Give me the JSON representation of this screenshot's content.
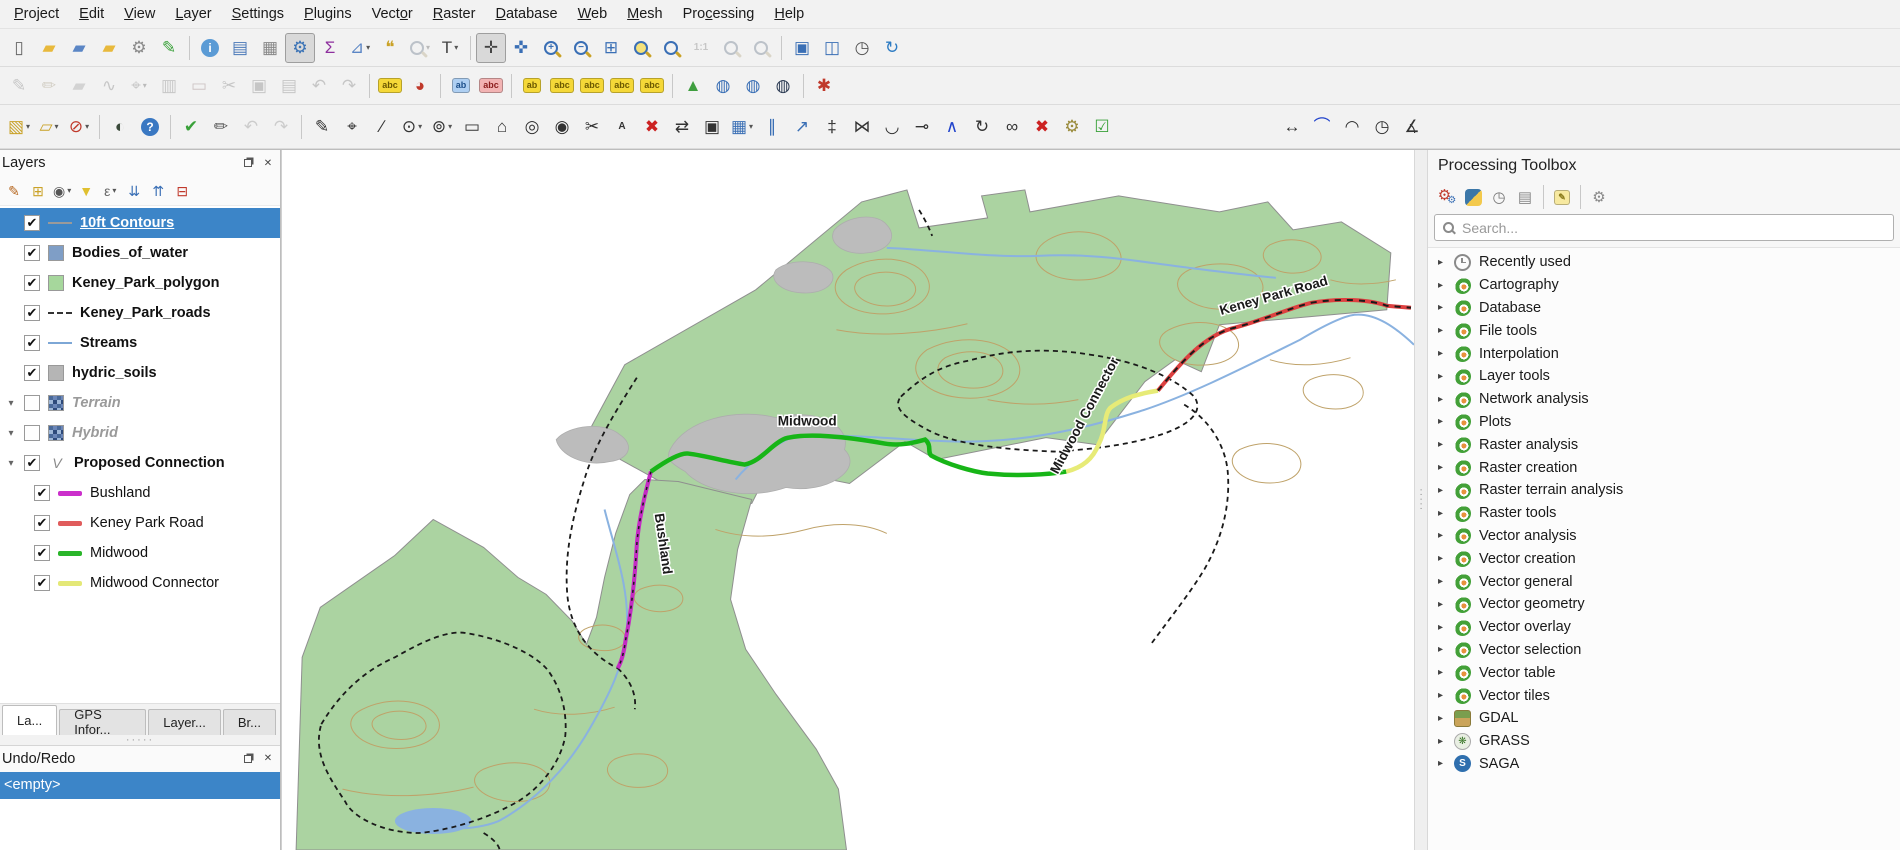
{
  "icons": {
    "close": "✕",
    "dropdown": "▾",
    "expander": "▾",
    "check": "✔",
    "tree_arrow": "▸",
    "grass_glyph": "❋",
    "saga_glyph": "S",
    "splitter_dots": "·····"
  },
  "menu": {
    "items": [
      {
        "label": "Project",
        "u": 0
      },
      {
        "label": "Edit",
        "u": 0
      },
      {
        "label": "View",
        "u": 0
      },
      {
        "label": "Layer",
        "u": 0
      },
      {
        "label": "Settings",
        "u": 0
      },
      {
        "label": "Plugins",
        "u": 0
      },
      {
        "label": "Vector",
        "u": 4
      },
      {
        "label": "Raster",
        "u": 0
      },
      {
        "label": "Database",
        "u": 0
      },
      {
        "label": "Web",
        "u": 0
      },
      {
        "label": "Mesh",
        "u": 0
      },
      {
        "label": "Processing",
        "u": 3
      },
      {
        "label": "Help",
        "u": 0
      }
    ]
  },
  "toolbars": {
    "row1": [
      {
        "n": "new-project",
        "g": "▯",
        "c": "#666"
      },
      {
        "n": "open-project",
        "g": "▰",
        "c": "#e8b93c"
      },
      {
        "n": "save-project",
        "g": "▰",
        "c": "#5b86c5"
      },
      {
        "n": "save-project-as",
        "g": "▰",
        "c": "#e8b93c"
      },
      {
        "n": "project-properties",
        "g": "⚙",
        "c": "#8a8a8a"
      },
      {
        "n": "style-manager",
        "g": "✎",
        "c": "#3aa13a"
      },
      {
        "sep": true
      },
      {
        "n": "identify-features",
        "g": "i",
        "c": "#fff",
        "round": true,
        "chipbg": "#5b9bd5"
      },
      {
        "n": "open-attribute-table",
        "g": "▤",
        "c": "#4a78b8"
      },
      {
        "n": "statistical-summary",
        "g": "▦",
        "c": "#888"
      },
      {
        "n": "processing-toolbox-toggle",
        "g": "⚙",
        "c": "#3871b5",
        "st": "checked"
      },
      {
        "n": "show-statistics",
        "g": "Σ",
        "c": "#8e2f9e"
      },
      {
        "n": "measure",
        "g": "⊿",
        "c": "#5b86c5",
        "dd": true
      },
      {
        "n": "map-tips",
        "g": "❝",
        "c": "#caa227"
      },
      {
        "n": "zoom-tool",
        "lens": true,
        "st": "disabled",
        "dd": true
      },
      {
        "n": "text-annotation",
        "g": "T",
        "c": "#444",
        "dd": true
      },
      {
        "sep": true
      },
      {
        "n": "pan-map",
        "g": "✛",
        "c": "#444",
        "st": "checked"
      },
      {
        "n": "pan-to-selection",
        "g": "✜",
        "c": "#3a6fb5"
      },
      {
        "n": "zoom-in",
        "lens": true,
        "g": "+"
      },
      {
        "n": "zoom-out",
        "lens": true,
        "g": "−"
      },
      {
        "n": "zoom-full",
        "g": "⊞",
        "c": "#3a6fb5"
      },
      {
        "n": "zoom-to-selection",
        "lens": true,
        "lensbg": "#f5e27a"
      },
      {
        "n": "zoom-to-layer",
        "lens": true
      },
      {
        "n": "zoom-native",
        "g": "1:1",
        "c": "#777",
        "small": true,
        "st": "disabled"
      },
      {
        "n": "zoom-last",
        "lens": true,
        "st": "disabled"
      },
      {
        "n": "zoom-next",
        "lens": true,
        "st": "disabled"
      },
      {
        "sep": true
      },
      {
        "n": "new-map-view",
        "g": "▣",
        "c": "#3a6fb5"
      },
      {
        "n": "new-3d-map-view",
        "g": "◫",
        "c": "#3a6fb5"
      },
      {
        "n": "temporal-controller",
        "g": "◷",
        "c": "#555"
      },
      {
        "n": "refresh-map",
        "g": "↻",
        "c": "#2e7cc3"
      }
    ],
    "row2": [
      {
        "n": "current-edits",
        "g": "✎",
        "c": "#777",
        "st": "disabled"
      },
      {
        "n": "toggle-editing",
        "g": "✏",
        "c": "#b08d2a",
        "st": "disabled"
      },
      {
        "n": "save-layer-edits",
        "g": "▰",
        "c": "#9a9a9a",
        "st": "disabled"
      },
      {
        "n": "add-line-feature",
        "g": "∿",
        "c": "#777",
        "st": "disabled"
      },
      {
        "n": "vertex-tool",
        "g": "⌖",
        "c": "#777",
        "st": "disabled",
        "dd": true
      },
      {
        "n": "multiedit-attributes",
        "g": "▥",
        "c": "#777",
        "st": "disabled"
      },
      {
        "n": "delete-selected",
        "g": "▭",
        "c": "#b66",
        "st": "disabled"
      },
      {
        "n": "cut-features",
        "g": "✂",
        "c": "#777",
        "st": "disabled"
      },
      {
        "n": "copy-features",
        "g": "▣",
        "c": "#777",
        "st": "disabled"
      },
      {
        "n": "paste-features",
        "g": "▤",
        "c": "#777",
        "st": "disabled"
      },
      {
        "n": "undo",
        "g": "↶",
        "c": "#777",
        "st": "disabled"
      },
      {
        "n": "redo",
        "g": "↷",
        "c": "#777",
        "st": "disabled"
      },
      {
        "sep": true
      },
      {
        "n": "layer-labeling",
        "chip": "abc",
        "chipbg": "#f5d838",
        "c": "#6b5800"
      },
      {
        "n": "layer-diagram",
        "g": "◕",
        "c": "#c0392b"
      },
      {
        "sep": true
      },
      {
        "n": "highlight-pinned-labels",
        "chip": "ab",
        "chipbg": "#aecff2",
        "c": "#1c4f8a"
      },
      {
        "n": "toggle-label-display",
        "chip": "abc",
        "chipbg": "#f2b3b3",
        "c": "#8a1c1c"
      },
      {
        "sep": true
      },
      {
        "n": "pin-unpin-labels",
        "chip": "ab",
        "chipbg": "#f5d838",
        "c": "#6b5800"
      },
      {
        "n": "show-hide-labels",
        "chip": "abc",
        "chipbg": "#f5d838",
        "c": "#6b5800"
      },
      {
        "n": "move-label",
        "chip": "abc",
        "chipbg": "#f5d838",
        "c": "#6b5800"
      },
      {
        "n": "rotate-label",
        "chip": "abc",
        "chipbg": "#f5d838",
        "c": "#6b5800"
      },
      {
        "n": "change-label",
        "chip": "abc",
        "chipbg": "#f5d838",
        "c": "#6b5800"
      },
      {
        "sep": true
      },
      {
        "n": "decorations",
        "g": "▲",
        "c": "#3f9e3f"
      },
      {
        "n": "metasearch",
        "g": "◍",
        "c": "#3a6fb5"
      },
      {
        "n": "web-globe",
        "g": "◍",
        "c": "#3a6fb5"
      },
      {
        "n": "metasearch-dark",
        "g": "◍",
        "c": "#2b3a52"
      },
      {
        "sep": true
      },
      {
        "n": "plugin-tool",
        "g": "✱",
        "c": "#c0392b"
      }
    ],
    "row3": [
      {
        "n": "select-features",
        "g": "▧",
        "c": "#c9a227",
        "dd": true
      },
      {
        "n": "select-by-form",
        "g": "▱",
        "c": "#c9a227",
        "dd": true
      },
      {
        "n": "deselect-features",
        "g": "⊘",
        "c": "#c0392b",
        "dd": true
      },
      {
        "sep": true
      },
      {
        "n": "night-sphere",
        "g": "◐",
        "c": "#3a4a3a"
      },
      {
        "n": "help-contents",
        "g": "?",
        "c": "#fff",
        "round": true,
        "chipbg": "#3a78c2"
      },
      {
        "sep": true
      },
      {
        "n": "snapping-toggle",
        "g": "✔",
        "c": "#3aa13a"
      },
      {
        "n": "edit-pencil",
        "g": "✏",
        "c": "#555"
      },
      {
        "n": "undo-edit",
        "g": "↶",
        "c": "#888",
        "st": "disabled"
      },
      {
        "n": "redo-edit",
        "g": "↷",
        "c": "#888",
        "st": "disabled"
      },
      {
        "sep": true
      },
      {
        "n": "digitize-curve",
        "g": "✎",
        "c": "#333"
      },
      {
        "n": "digitize-point",
        "g": "⌖",
        "c": "#333"
      },
      {
        "n": "digitize-line",
        "g": "∕",
        "c": "#333"
      },
      {
        "n": "digitize-circle",
        "g": "⊙",
        "c": "#333",
        "dd": true
      },
      {
        "n": "digitize-ellipse",
        "g": "⊚",
        "c": "#333",
        "dd": true
      },
      {
        "n": "digitize-rect",
        "g": "▭",
        "c": "#333"
      },
      {
        "n": "digitize-polygon",
        "g": "⌂",
        "c": "#333"
      },
      {
        "n": "digitize-annulus",
        "g": "◎",
        "c": "#333"
      },
      {
        "n": "stamp-tool",
        "g": "◉",
        "c": "#333"
      },
      {
        "n": "split-features",
        "g": "✂",
        "c": "#333"
      },
      {
        "n": "marker-a",
        "g": "A",
        "c": "#333",
        "small": true
      },
      {
        "n": "delete-part",
        "g": "✖",
        "c": "#cc2222"
      },
      {
        "n": "move-feature",
        "g": "⇄",
        "c": "#333"
      },
      {
        "n": "copy-move-feature",
        "g": "▣",
        "c": "#333"
      },
      {
        "n": "grid-tool",
        "g": "▦",
        "c": "#3a6fb5",
        "dd": true
      },
      {
        "n": "parallel-lines",
        "g": "∥",
        "c": "#3a6fb5"
      },
      {
        "n": "arrow-tool",
        "g": "↗",
        "c": "#3a6fb5"
      },
      {
        "n": "offset-tool",
        "g": "‡",
        "c": "#333"
      },
      {
        "n": "mirror-tool",
        "g": "⋈",
        "c": "#333"
      },
      {
        "n": "fillet-tool",
        "g": "◡",
        "c": "#333"
      },
      {
        "n": "extend-tool",
        "g": "⊸",
        "c": "#333"
      },
      {
        "n": "vertex-plus",
        "g": "∧",
        "c": "#2244cc"
      },
      {
        "n": "rotate-point",
        "g": "↻",
        "c": "#333"
      },
      {
        "n": "merge-lines",
        "g": "∞",
        "c": "#333"
      },
      {
        "n": "delete-red",
        "g": "✖",
        "c": "#cc2222"
      },
      {
        "n": "spanner",
        "g": "⚙",
        "c": "#998a3a"
      },
      {
        "n": "validate",
        "g": "☑",
        "c": "#3aa13a"
      },
      {
        "gap": true
      },
      {
        "n": "measure-length",
        "g": "↔",
        "c": "#333"
      },
      {
        "n": "measure-curve",
        "g": "⌒",
        "c": "#2244cc"
      },
      {
        "n": "measure-arc",
        "g": "◠",
        "c": "#333"
      },
      {
        "n": "measure-angle-clock",
        "g": "◷",
        "c": "#333"
      },
      {
        "n": "measure-azimuth",
        "g": "∡",
        "c": "#333"
      }
    ]
  },
  "layers_panel": {
    "title": "Layers",
    "toolbar": [
      {
        "n": "open-layer-styling",
        "g": "✎",
        "c": "#b5651d"
      },
      {
        "n": "add-group",
        "g": "⊞",
        "c": "#caa227"
      },
      {
        "n": "manage-map-themes",
        "g": "◉",
        "c": "#555",
        "dd": true
      },
      {
        "n": "filter-legend",
        "g": "▼",
        "c": "#e0c030"
      },
      {
        "n": "filter-by-expression",
        "g": "ε",
        "c": "#666",
        "dd": true
      },
      {
        "n": "expand-all",
        "g": "⇊",
        "c": "#3a6fb5"
      },
      {
        "n": "collapse-all",
        "g": "⇈",
        "c": "#3a6fb5"
      },
      {
        "n": "remove-layer",
        "g": "⊟",
        "c": "#c0392b"
      }
    ],
    "items": [
      {
        "label": "10ft Contours",
        "checked": true,
        "selected": true,
        "swatch": "line",
        "color": "#9a9a9a"
      },
      {
        "label": "Bodies_of_water",
        "checked": true,
        "swatch": "fill",
        "color": "#7f9ec6"
      },
      {
        "label": "Keney_Park_polygon",
        "checked": true,
        "swatch": "fill",
        "color": "#a6d79c"
      },
      {
        "label": "Keney_Park_roads",
        "checked": true,
        "swatch": "dash",
        "color": "#333333"
      },
      {
        "label": "Streams",
        "checked": true,
        "swatch": "line",
        "color": "#7da7d6"
      },
      {
        "label": "hydric_soils",
        "checked": true,
        "swatch": "fill",
        "color": "#b5b5b5"
      },
      {
        "label": "Terrain",
        "checked": false,
        "italic": true,
        "expander": true,
        "swatch": "tiles"
      },
      {
        "label": "Hybrid",
        "checked": false,
        "italic": true,
        "expander": true,
        "swatch": "tiles"
      },
      {
        "label": "Proposed Connection",
        "checked": true,
        "expander": true,
        "swatch": "vector",
        "glyph": "V"
      },
      {
        "label": "Bushland",
        "checked": true,
        "child": true,
        "swatch": "thickline",
        "color": "#cb2fcb"
      },
      {
        "label": "Keney Park Road",
        "checked": true,
        "child": true,
        "swatch": "thickline",
        "color": "#e05c5c"
      },
      {
        "label": "Midwood",
        "checked": true,
        "child": true,
        "swatch": "thickline",
        "color": "#2ab52a"
      },
      {
        "label": "Midwood Connector",
        "checked": true,
        "child": true,
        "swatch": "thickline",
        "color": "#e4e877"
      }
    ],
    "tabs": {
      "active": 0,
      "items": [
        "La...",
        "GPS Infor...",
        "Layer...",
        "Br..."
      ]
    }
  },
  "undo_panel": {
    "title": "Undo/Redo",
    "rows": [
      "<empty>"
    ]
  },
  "map": {
    "labels": {
      "midwood": "Midwood",
      "midwood_connector": "Midwood Connector",
      "bushland": "Bushland",
      "keney_park_road": "Keney Park Road"
    },
    "colors": {
      "park_fill": "#abd3a1",
      "park_stroke": "#8f8f8f",
      "contour": "#bfa269",
      "stream": "#8ab2e0",
      "soil": "#bcbcbc",
      "road_dash": "#1a1a1a",
      "trail_bushland": "#c42bc4",
      "trail_keney_park_road": "#dd4040",
      "trail_midwood": "#17b517",
      "trail_midwood_connector": "#e7eb77"
    }
  },
  "processing_panel": {
    "title": "Processing Toolbox",
    "search_placeholder": "Search...",
    "toolbar": [
      {
        "n": "processing-models",
        "g": "⚙",
        "c": "#c0392b"
      },
      {
        "n": "python",
        "py": true
      },
      {
        "n": "history",
        "g": "◷",
        "c": "#777"
      },
      {
        "n": "results-viewer",
        "g": "▤",
        "c": "#888"
      },
      {
        "sep": true
      },
      {
        "n": "edit-features-in-place",
        "chip": "✎",
        "chipbg": "#f7e9a0",
        "c": "#8a7a1a"
      },
      {
        "sep": true
      },
      {
        "n": "options",
        "g": "⚙",
        "c": "#8a8a8a"
      }
    ],
    "items": [
      {
        "label": "Recently used",
        "icon": "clock"
      },
      {
        "label": "Cartography",
        "icon": "q"
      },
      {
        "label": "Database",
        "icon": "q"
      },
      {
        "label": "File tools",
        "icon": "q"
      },
      {
        "label": "Interpolation",
        "icon": "q"
      },
      {
        "label": "Layer tools",
        "icon": "q"
      },
      {
        "label": "Network analysis",
        "icon": "q"
      },
      {
        "label": "Plots",
        "icon": "q"
      },
      {
        "label": "Raster analysis",
        "icon": "q"
      },
      {
        "label": "Raster creation",
        "icon": "q"
      },
      {
        "label": "Raster terrain analysis",
        "icon": "q"
      },
      {
        "label": "Raster tools",
        "icon": "q"
      },
      {
        "label": "Vector analysis",
        "icon": "q"
      },
      {
        "label": "Vector creation",
        "icon": "q"
      },
      {
        "label": "Vector general",
        "icon": "q"
      },
      {
        "label": "Vector geometry",
        "icon": "q"
      },
      {
        "label": "Vector overlay",
        "icon": "q"
      },
      {
        "label": "Vector selection",
        "icon": "q"
      },
      {
        "label": "Vector table",
        "icon": "q"
      },
      {
        "label": "Vector tiles",
        "icon": "q"
      },
      {
        "label": "GDAL",
        "icon": "gdal"
      },
      {
        "label": "GRASS",
        "icon": "grass"
      },
      {
        "label": "SAGA",
        "icon": "saga"
      }
    ]
  }
}
